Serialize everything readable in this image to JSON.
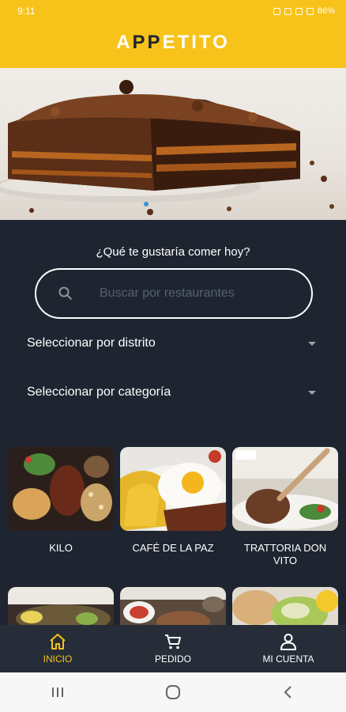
{
  "status_bar": {
    "time": "9:11",
    "battery": "86%"
  },
  "app": {
    "brand_prefix": "A",
    "brand_pp": "PP",
    "brand_suffix": "ETITO"
  },
  "search": {
    "question": "¿Qué te gustaría comer hoy?",
    "placeholder": "Buscar por restaurantes"
  },
  "filters": {
    "district_label": "Seleccionar por distrito",
    "category_label": "Seleccionar por categoría"
  },
  "restaurants": [
    {
      "name": "KILO"
    },
    {
      "name": "CAFÉ DE LA PAZ"
    },
    {
      "name": "TRATTORIA DON VITO"
    },
    {
      "name": ""
    },
    {
      "name": ""
    },
    {
      "name": ""
    }
  ],
  "bottom_nav": [
    {
      "label": "INICIO",
      "icon": "home-icon",
      "active": true
    },
    {
      "label": "PEDIDO",
      "icon": "cart-icon",
      "active": false
    },
    {
      "label": "MI CUENTA",
      "icon": "user-icon",
      "active": false
    }
  ],
  "colors": {
    "accent": "#f7c31a",
    "background": "#1e2530",
    "nav": "#262d38"
  }
}
